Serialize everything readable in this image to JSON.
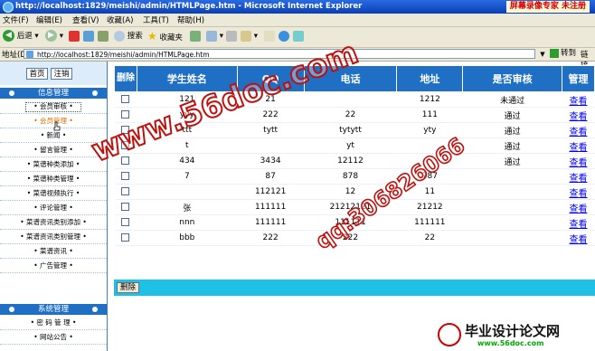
{
  "window": {
    "title": "http://localhost:1829/meishi/admin/HTMLPage.htm - Microsoft Internet Explorer",
    "promo": "屏幕录像专家 未注册"
  },
  "menu": [
    "文件(F)",
    "编辑(E)",
    "查看(V)",
    "收藏(A)",
    "工具(T)",
    "帮助(H)"
  ],
  "toolbar": {
    "back": "后退",
    "search": "搜索",
    "favorites": "收藏夹"
  },
  "address": {
    "label": "地址(D)",
    "url": "http://localhost:1829/meishi/admin/HTMLPage.htm",
    "go": "转到",
    "links": "链接"
  },
  "sidebar": {
    "home_btn": "首页",
    "logout_btn": "注销",
    "sections": [
      {
        "title": "信息管理",
        "items": [
          "• 会员审核 •",
          "• 会员管理 •",
          "• 新闻 •",
          "• 留言管理 •",
          "• 菜谱种类添加 •",
          "• 菜谱种类管理 •",
          "• 菜谱视频执行 •",
          "• 评论管理 •",
          "• 菜谱资讯类别添加 •",
          "• 菜谱资讯类别管理 •",
          "• 菜谱资讯 •",
          "• 广告管理 •"
        ]
      },
      {
        "title": "系统管理",
        "items": [
          "• 密 码 管 理 •",
          "• 网站公告 •"
        ]
      }
    ]
  },
  "table": {
    "headers": [
      "删除",
      "学生姓名",
      "QQ",
      "电话",
      "地址",
      "是否审核",
      "管理"
    ],
    "rows": [
      {
        "name": "121",
        "qq": "21",
        "phone": "",
        "addr": "1212",
        "status": "未通过",
        "action": "查看"
      },
      {
        "name": "yyy",
        "qq": "222",
        "phone": "22",
        "addr": "111",
        "status": "通过",
        "action": "查看"
      },
      {
        "name": "ttt",
        "qq": "tytt",
        "phone": "tytytt",
        "addr": "yty",
        "status": "通过",
        "action": "查看"
      },
      {
        "name": "t",
        "qq": "",
        "phone": "yt",
        "addr": "",
        "status": "通过",
        "action": "查看"
      },
      {
        "name": "434",
        "qq": "3434",
        "phone": "12112",
        "addr": "",
        "status": "通过",
        "action": "查看"
      },
      {
        "name": "7",
        "qq": "87",
        "phone": "878",
        "addr": "787",
        "status": "",
        "action": "查看"
      },
      {
        "name": "",
        "qq": "112121",
        "phone": "12",
        "addr": "11",
        "status": "",
        "action": "查看"
      },
      {
        "name": "张",
        "qq": "111111",
        "phone": "21212121",
        "addr": "21212",
        "status": "",
        "action": "查看"
      },
      {
        "name": "nnn",
        "qq": "111111",
        "phone": "111111",
        "addr": "111111",
        "status": "",
        "action": "查看"
      },
      {
        "name": "bbb",
        "qq": "222",
        "phone": "222",
        "addr": "22",
        "status": "",
        "action": "查看"
      }
    ],
    "delete_button": "删除"
  },
  "watermarks": {
    "site": "www.56doc.com",
    "qq": "qq:306826066"
  },
  "logo": {
    "title": "毕业设计论文网",
    "url": "www.56doc.com"
  },
  "colors": {
    "header": "#1f6fc5",
    "footer": "#1fc0e6",
    "watermark": "#c0100c"
  }
}
